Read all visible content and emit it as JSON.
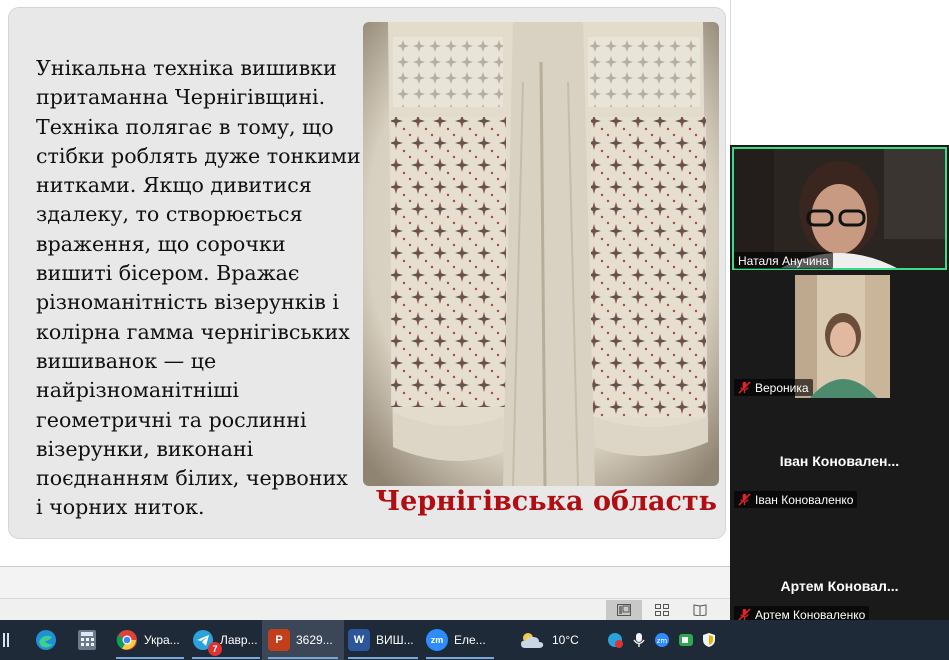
{
  "slide": {
    "body_text": "Унікальна техніка вишивки притаманна Чернігівщині. Техніка полягає в тому, що стібки роблять дуже тонкими нитками. Якщо дивитися здалеку, то створюється враження, що сорочки вишиті бісером.  Вражає різноманітність візерунків і колірна гамма чернігівських вишиванок — це найрізноманітніші геометричні та рослинні візерунки, виконані поєднанням білих, червоних і чорних ниток.",
    "caption": "Чернігівська область",
    "caption_color": "#b00e12"
  },
  "status_bar": {
    "view_buttons": [
      "normal-view-icon",
      "slide-sorter-icon",
      "reading-view-icon"
    ]
  },
  "zoom": {
    "participants": [
      {
        "name": "Наталя Анучина",
        "video": true,
        "muted": false,
        "speaking": true
      },
      {
        "name": "Вероника",
        "video": true,
        "muted": true
      },
      {
        "name": "Іван Коноваленко",
        "display_name": "Іван  Коновален...",
        "video": false,
        "muted": true
      },
      {
        "name": "Артем Коноваленко",
        "display_name": "Артем  Коновал...",
        "video": false,
        "muted": true
      }
    ],
    "active_speaker_border": "#3ddc84"
  },
  "taskbar": {
    "apps": [
      {
        "icon": "edge-icon",
        "label": ""
      },
      {
        "icon": "calculator-icon",
        "label": ""
      },
      {
        "icon": "chrome-icon",
        "label": "Укра..."
      },
      {
        "icon": "telegram-icon",
        "label": "Лавр...",
        "badge": "7"
      },
      {
        "icon": "powerpoint-icon",
        "label": "3629..."
      },
      {
        "icon": "word-icon",
        "label": "ВИШ..."
      },
      {
        "icon": "zoom-icon",
        "label": "Еле..."
      }
    ],
    "weather": "10°C",
    "tray_icons": [
      "telegram-tray-icon",
      "microphone-icon",
      "zoom-tray-icon",
      "meet-tray-icon",
      "security-tray-icon"
    ]
  }
}
